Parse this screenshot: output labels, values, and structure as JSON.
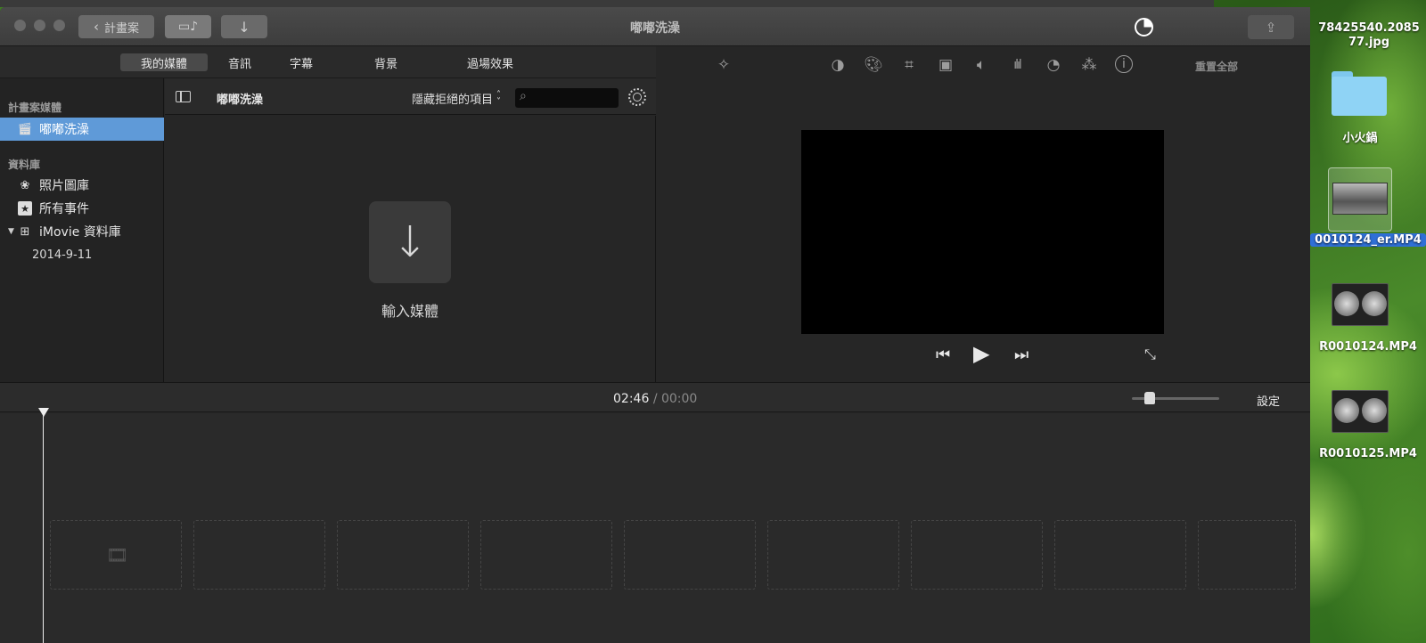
{
  "window": {
    "title": "嘟嘟洗澡",
    "back_label": "計畫案",
    "media_toggle_glyph": "▭♪",
    "import_glyph": "↓",
    "share_glyph": "⇪"
  },
  "tabs": [
    {
      "label": "我的媒體",
      "active": true
    },
    {
      "label": "音訊",
      "active": false
    },
    {
      "label": "字幕",
      "active": false
    },
    {
      "label": "背景",
      "active": false
    },
    {
      "label": "過場效果",
      "active": false
    }
  ],
  "sidebar": {
    "section_project": "計畫案媒體",
    "project_item": "嘟嘟洗澡",
    "section_library": "資料庫",
    "items": [
      {
        "label": "照片圖庫",
        "icon": "flower-icon"
      },
      {
        "label": "所有事件",
        "icon": "star-box-icon"
      },
      {
        "label": "iMovie 資料庫",
        "icon": "grid-icon"
      }
    ],
    "event": "2014-9-11"
  },
  "browser": {
    "title": "嘟嘟洗澡",
    "filter_label": "隱藏拒絕的項目",
    "search_placeholder": "",
    "import_label": "輸入媒體"
  },
  "viewer": {
    "reset_all": "重置全部",
    "tools": [
      "magic-wand-icon",
      "color-balance-icon",
      "color-correction-icon",
      "crop-icon",
      "stabilization-icon",
      "volume-icon",
      "equalizer-icon",
      "speed-icon",
      "filter-icon",
      "info-icon"
    ]
  },
  "timeline": {
    "current_time": "02:46",
    "separator": "/",
    "total_time": "00:00",
    "settings_label": "設定",
    "slot_count": 9
  },
  "desktop": {
    "items": [
      {
        "label": "78425540.2085\n77.jpg"
      },
      {
        "label": "小火鍋"
      },
      {
        "label": "0010124_er.MP4",
        "selected": true
      },
      {
        "label": "R0010124.MP4"
      },
      {
        "label": "R0010125.MP4"
      }
    ]
  },
  "colors": {
    "selection": "#5f9ad8",
    "window_bg": "#262626"
  }
}
